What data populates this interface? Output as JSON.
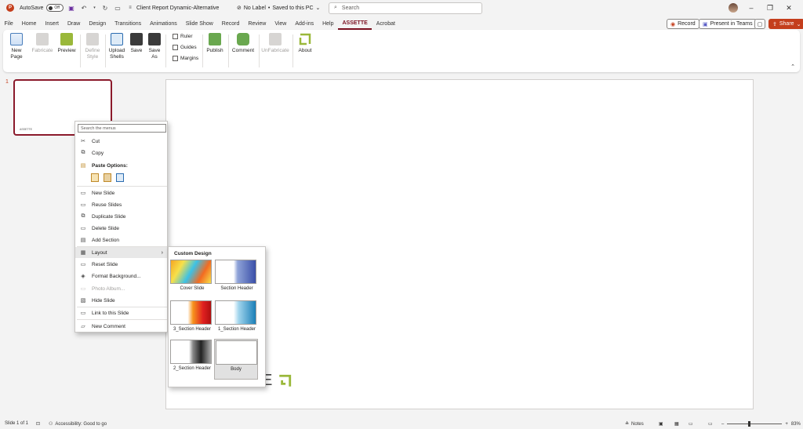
{
  "titlebar": {
    "autosave_label": "AutoSave",
    "autosave_state": "Off",
    "doc_title": "Client Report Dynamic-Alternative",
    "label_status": "No Label",
    "save_status": "Saved to this PC",
    "search_placeholder": "Search"
  },
  "tabs": [
    "File",
    "Home",
    "Insert",
    "Draw",
    "Design",
    "Transitions",
    "Animations",
    "Slide Show",
    "Record",
    "Review",
    "View",
    "Add-ins",
    "Help",
    "ASSETTE",
    "Acrobat"
  ],
  "active_tab": "ASSETTE",
  "tab_actions": {
    "record": "Record",
    "present": "Present in Teams",
    "share": "Share"
  },
  "ribbon": {
    "new_page": "New\nPage",
    "fabricate": "Fabricate",
    "preview": "Preview",
    "define_style": "Define\nStyle",
    "upload_shells": "Upload\nShells",
    "save": "Save",
    "save_as": "Save\nAs",
    "ruler": "Ruler",
    "guides": "Guides",
    "margins": "Margins",
    "publish": "Publish",
    "comment": "Comment",
    "unfabricate": "UnFabricate",
    "about": "About"
  },
  "thumbnail": {
    "number": "1",
    "brand": "ASSETTE"
  },
  "slide_logo_text": "E",
  "context_menu": {
    "search_placeholder": "Search the menus",
    "cut": "Cut",
    "copy": "Copy",
    "paste_options": "Paste Options:",
    "new_slide": "New Slide",
    "reuse_slides": "Reuse Slides",
    "duplicate_slide": "Duplicate Slide",
    "delete_slide": "Delete Slide",
    "add_section": "Add Section",
    "layout": "Layout",
    "reset_slide": "Reset Slide",
    "format_background": "Format Background...",
    "photo_album": "Photo Album...",
    "hide_slide": "Hide Slide",
    "link_to_slide": "Link to this Slide",
    "new_comment": "New Comment"
  },
  "layout_submenu": {
    "title": "Custom Design",
    "layouts": [
      "Cover Slide",
      "Section Header",
      "3_Section Header",
      "1_Section Header",
      "2_Section Header",
      "Body"
    ],
    "selected": "Body"
  },
  "statusbar": {
    "slide_count": "Slide 1 of 1",
    "accessibility": "Accessibility: Good to go",
    "notes": "Notes",
    "zoom": "83%",
    "zoom_percent": 83
  },
  "colors": {
    "accent": "#7a1020",
    "share": "#c43e1c",
    "assette_green": "#9ab83a"
  }
}
